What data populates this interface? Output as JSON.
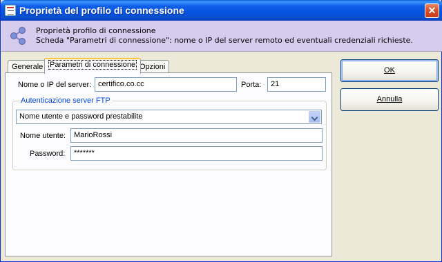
{
  "window": {
    "title": "Proprietà del profilo di connessione",
    "close_glyph": "✕"
  },
  "header": {
    "icon": "share-network-icon",
    "line1": "Proprietà profilo di connessione",
    "line2": "Scheda \"Parametri di connessione\": nome o IP del server remoto ed eventuali credenziali richieste."
  },
  "tabs": [
    {
      "label": "Generale",
      "active": false
    },
    {
      "label": "Parametri di connessione",
      "active": true
    },
    {
      "label": "Opzioni",
      "active": false
    }
  ],
  "connection": {
    "server_label": "Nome o IP del server:",
    "server_value": "certifico.co.cc",
    "port_label": "Porta:",
    "port_value": "21"
  },
  "auth": {
    "group_title": "Autenticazione server FTP",
    "mode_selected": "Nome utente e password prestabilite",
    "username_label": "Nome utente:",
    "username_value": "MarioRossi",
    "password_label": "Password:",
    "password_value": "*******"
  },
  "buttons": {
    "ok_label": "OK",
    "cancel_label": "Annulla"
  },
  "colors": {
    "titlebar": "#0553e0",
    "header_bg": "#d5ccee",
    "group_title": "#0046d5",
    "tab_highlight": "#ffc83c"
  }
}
